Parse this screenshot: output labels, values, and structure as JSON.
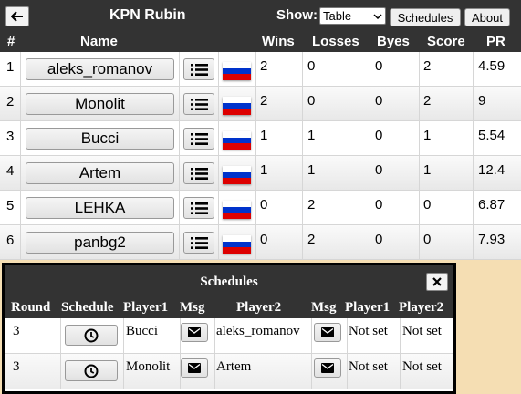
{
  "header": {
    "back_icon": "arrow-left-icon",
    "title": "KPN Rubin",
    "show_label": "Show:",
    "show_selected": "Table",
    "schedules_button": "Schedules",
    "about_button": "About"
  },
  "columns": [
    "#",
    "Name",
    "Wins",
    "Losses",
    "Byes",
    "Score",
    "PR"
  ],
  "players": [
    {
      "rank": "1",
      "name": "aleks_romanov",
      "wins": "2",
      "losses": "0",
      "byes": "0",
      "score": "2",
      "pr": "4.59"
    },
    {
      "rank": "2",
      "name": "Monolit",
      "wins": "2",
      "losses": "0",
      "byes": "0",
      "score": "2",
      "pr": "9"
    },
    {
      "rank": "3",
      "name": "Bucci",
      "wins": "1",
      "losses": "1",
      "byes": "0",
      "score": "1",
      "pr": "5.54"
    },
    {
      "rank": "4",
      "name": "Artem",
      "wins": "1",
      "losses": "1",
      "byes": "0",
      "score": "1",
      "pr": "12.4"
    },
    {
      "rank": "5",
      "name": "LEHKA",
      "wins": "0",
      "losses": "2",
      "byes": "0",
      "score": "0",
      "pr": "6.87"
    },
    {
      "rank": "6",
      "name": "panbg2",
      "wins": "0",
      "losses": "2",
      "byes": "0",
      "score": "0",
      "pr": "7.93"
    }
  ],
  "flag_colors": [
    "#ffffff",
    "#0033cc",
    "#dd0000"
  ],
  "schedules": {
    "title": "Schedules",
    "close_icon": "close-icon",
    "columns": [
      "Round",
      "Schedule",
      "Player1",
      "Msg",
      "Player2",
      "Msg",
      "Player1",
      "Player2"
    ],
    "rows": [
      {
        "round": "3",
        "player1": "Bucci",
        "player2": "aleks_romanov",
        "p1_status": "Not set",
        "p2_status": "Not set"
      },
      {
        "round": "3",
        "player1": "Monolit",
        "player2": "Artem",
        "p1_status": "Not set",
        "p2_status": "Not set"
      }
    ]
  }
}
